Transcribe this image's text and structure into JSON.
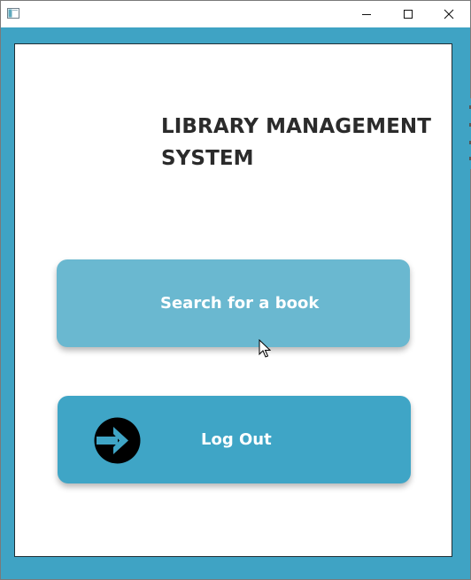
{
  "window": {
    "title": "",
    "controls": [
      "minimize-icon",
      "maximize-icon",
      "close-icon"
    ],
    "accent_color": "#3fa3c4"
  },
  "header": {
    "title_line1": "LIBRARY MANAGEMENT",
    "title_line2": "SYSTEM"
  },
  "actions": {
    "search_label": "Search for a book",
    "search_color": "#6ab8d0",
    "logout_label": "Log Out",
    "logout_color": "#3fa5c6",
    "logout_icon": "log-out-arrow-icon"
  }
}
